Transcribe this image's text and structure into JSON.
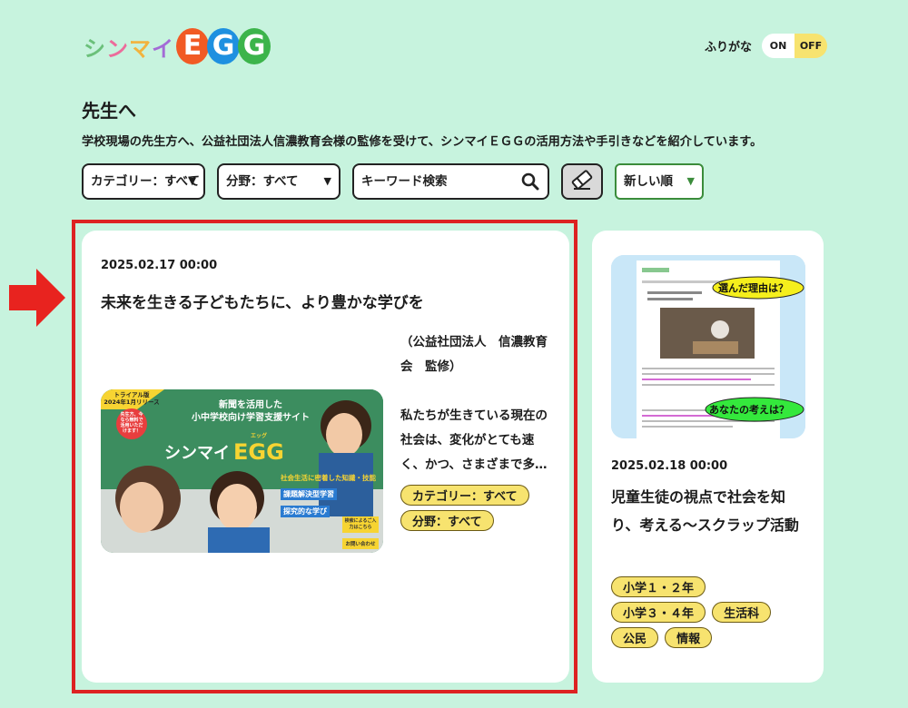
{
  "logo": {
    "kana": "シンマイ",
    "egg": "EGG",
    "colors": {
      "kana": [
        "#6bc07a",
        "#ec6c9b",
        "#f2b33d",
        "#a36bd6"
      ],
      "egg": [
        "#f15a24",
        "#1e90e0",
        "#3cb44b"
      ]
    }
  },
  "furigana": {
    "label": "ふりがな",
    "on": "ON",
    "off": "OFF"
  },
  "page": {
    "title": "先生へ",
    "description": "学校現場の先生方へ、公益社団法人信濃教育会様の監修を受けて、シンマイＥＧＧの活用方法や手引きなどを紹介しています。"
  },
  "filters": {
    "category": "カテゴリー：すべて",
    "field": "分野：すべて",
    "search_placeholder": "キーワード検索",
    "sort": "新しい順"
  },
  "cards": [
    {
      "date": "2025.02.17 00:00",
      "title": "未来を生きる子どもたちに、より豊かな学びを",
      "text1": "（公益社団法人　信濃教育会　監修）",
      "text2": "私たちが生きている現在の社会は、変化がとても速く、かつ、さまざまで多…",
      "tags": [
        "カテゴリー：すべて",
        "分野：すべて"
      ],
      "image": {
        "banner": "トライアル版\n2024年1月リリース",
        "badge": "先生方、今なら無料で活用いただけます！",
        "line1": "新聞を活用した",
        "line2": "小中学校向け学習支援サイト",
        "ruby": "エッグ",
        "logo_kana": "シンマイ",
        "logo_egg": "EGG",
        "point1": "社会生活に密着した知識・技能",
        "point2": "課題解決型学習",
        "point3": "探究的な学び",
        "btn1": "検索によるご入力はこちら",
        "btn2": "お問い合わせ"
      }
    },
    {
      "date": "2025.02.18 00:00",
      "title": "児童生徒の視点で社会を知り、考える〜スクラップ活動",
      "tags": [
        "小学１・２年",
        "小学３・４年",
        "生活科",
        "公民",
        "情報"
      ],
      "image": {
        "bubble1": "選んだ理由は？",
        "bubble2": "あなたの考えは？"
      }
    }
  ]
}
